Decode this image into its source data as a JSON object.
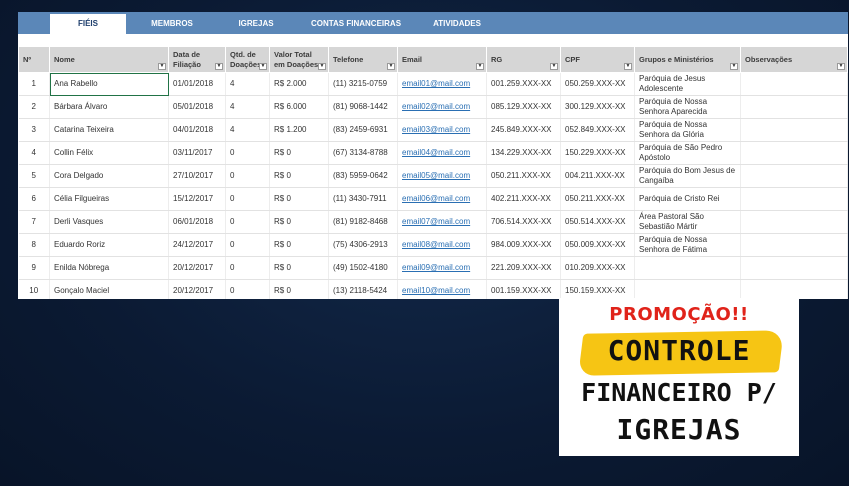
{
  "tabs": [
    {
      "label": "FIÉIS"
    },
    {
      "label": "MEMBROS"
    },
    {
      "label": "IGREJAS"
    },
    {
      "label": "CONTAS FINANCEIRAS"
    },
    {
      "label": "ATIVIDADES"
    }
  ],
  "columns": [
    "Nº",
    "Nome",
    "Data de Filiação",
    "Qtd. de Doações",
    "Valor Total em Doações",
    "Telefone",
    "Email",
    "RG",
    "CPF",
    "Grupos e Ministérios",
    "Observações"
  ],
  "rows": [
    {
      "n": "1",
      "nome": "Ana Rabello",
      "data": "01/01/2018",
      "qtd": "4",
      "valor": "R$ 2.000",
      "tel": "(11) 3215-0759",
      "email": "email01@mail.com",
      "rg": "001.259.XXX-XX",
      "cpf": "050.259.XXX-XX",
      "grupo": "Paróquia de Jesus Adolescente",
      "obs": ""
    },
    {
      "n": "2",
      "nome": "Bárbara Álvaro",
      "data": "05/01/2018",
      "qtd": "4",
      "valor": "R$ 6.000",
      "tel": "(81) 9068-1442",
      "email": "email02@mail.com",
      "rg": "085.129.XXX-XX",
      "cpf": "300.129.XXX-XX",
      "grupo": "Paróquia de Nossa Senhora Aparecida",
      "obs": ""
    },
    {
      "n": "3",
      "nome": "Catarina Teixeira",
      "data": "04/01/2018",
      "qtd": "4",
      "valor": "R$ 1.200",
      "tel": "(83) 2459-6931",
      "email": "email03@mail.com",
      "rg": "245.849.XXX-XX",
      "cpf": "052.849.XXX-XX",
      "grupo": "Paróquia de Nossa Senhora da Glória",
      "obs": ""
    },
    {
      "n": "4",
      "nome": "Collin Félix",
      "data": "03/11/2017",
      "qtd": "0",
      "valor": "R$ 0",
      "tel": "(67) 3134-8788",
      "email": "email04@mail.com",
      "rg": "134.229.XXX-XX",
      "cpf": "150.229.XXX-XX",
      "grupo": "Paróquia de São Pedro Apóstolo",
      "obs": ""
    },
    {
      "n": "5",
      "nome": "Cora Delgado",
      "data": "27/10/2017",
      "qtd": "0",
      "valor": "R$ 0",
      "tel": "(83) 5959-0642",
      "email": "email05@mail.com",
      "rg": "050.211.XXX-XX",
      "cpf": "004.211.XXX-XX",
      "grupo": "Paróquia do Bom Jesus de Cangaíba",
      "obs": ""
    },
    {
      "n": "6",
      "nome": "Célia Filgueiras",
      "data": "15/12/2017",
      "qtd": "0",
      "valor": "R$ 0",
      "tel": "(11) 3430-7911",
      "email": "email06@mail.com",
      "rg": "402.211.XXX-XX",
      "cpf": "050.211.XXX-XX",
      "grupo": "Paróquia de Cristo Rei",
      "obs": ""
    },
    {
      "n": "7",
      "nome": "Derli Vasques",
      "data": "06/01/2018",
      "qtd": "0",
      "valor": "R$ 0",
      "tel": "(81) 9182-8468",
      "email": "email07@mail.com",
      "rg": "706.514.XXX-XX",
      "cpf": "050.514.XXX-XX",
      "grupo": "Área Pastoral São Sebastião Mártir",
      "obs": ""
    },
    {
      "n": "8",
      "nome": "Eduardo Roriz",
      "data": "24/12/2017",
      "qtd": "0",
      "valor": "R$ 0",
      "tel": "(75) 4306-2913",
      "email": "email08@mail.com",
      "rg": "984.009.XXX-XX",
      "cpf": "050.009.XXX-XX",
      "grupo": "Paróquia de Nossa Senhora de Fátima",
      "obs": ""
    },
    {
      "n": "9",
      "nome": "Enilda Nóbrega",
      "data": "20/12/2017",
      "qtd": "0",
      "valor": "R$ 0",
      "tel": "(49) 1502-4180",
      "email": "email09@mail.com",
      "rg": "221.209.XXX-XX",
      "cpf": "010.209.XXX-XX",
      "grupo": "",
      "obs": ""
    },
    {
      "n": "10",
      "nome": "Gonçalo Maciel",
      "data": "20/12/2017",
      "qtd": "0",
      "valor": "R$ 0",
      "tel": "(13) 2118-5424",
      "email": "email10@mail.com",
      "rg": "001.159.XXX-XX",
      "cpf": "150.159.XXX-XX",
      "grupo": "",
      "obs": ""
    }
  ],
  "promo": {
    "line1": "PROMOÇÃO!!",
    "line2": "CONTROLE",
    "line3": "FINANCEIRO P/",
    "line4": "IGREJAS"
  },
  "colors": {
    "tabbar": "#5b87b8",
    "header": "#d6d6d6",
    "link": "#2a6fb3",
    "promo_red": "#e0231a",
    "promo_yellow": "#f6c514"
  }
}
